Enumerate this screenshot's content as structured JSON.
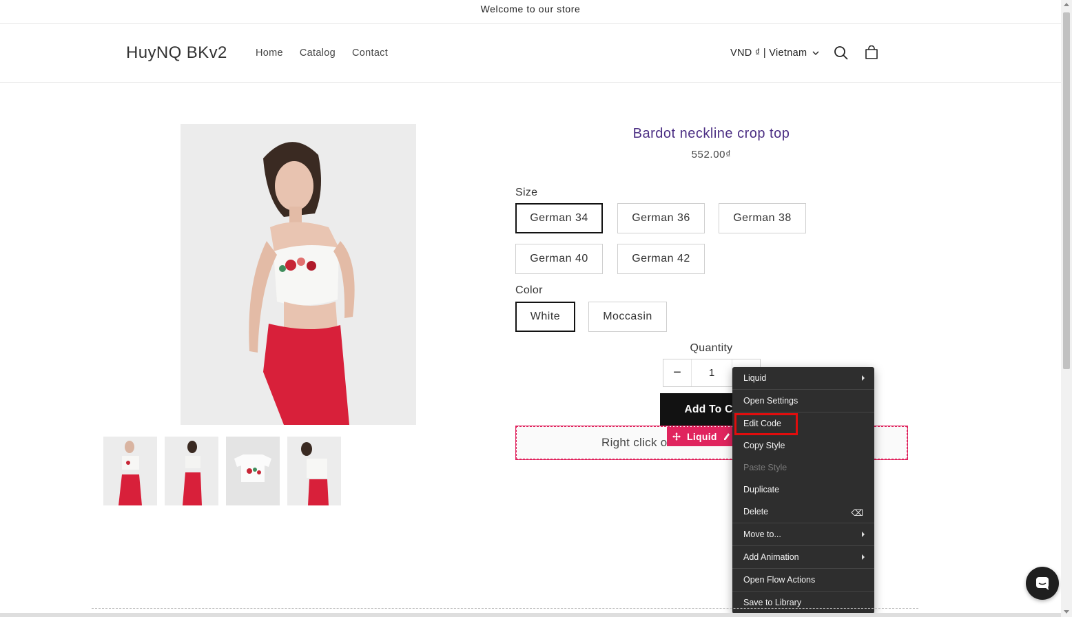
{
  "announcement": {
    "text": "Welcome to our store"
  },
  "header": {
    "logo": "HuyNQ BKv2",
    "nav": [
      "Home",
      "Catalog",
      "Contact"
    ],
    "currency": "VND ₫ | Vietnam",
    "icons": [
      "search-icon",
      "cart-icon",
      "chevron-down-icon"
    ]
  },
  "product": {
    "title": "Bardot neckline crop top",
    "price": "552.00₫",
    "size_label": "Size",
    "sizes": [
      "German 34",
      "German 36",
      "German 38",
      "German 40",
      "German 42"
    ],
    "selected_size": "German 34",
    "color_label": "Color",
    "colors": [
      "White",
      "Moccasin"
    ],
    "selected_color": "White",
    "quantity_label": "Quantity",
    "quantity": "1",
    "minus": "−",
    "add_to_cart": "Add To Ca"
  },
  "liquid": {
    "placeholder": "Right click o",
    "badge": "Liquid",
    "accent": "#e0245e"
  },
  "context_menu": {
    "items": [
      {
        "label": "Liquid",
        "submenu": true
      },
      {
        "label": "Open Settings"
      },
      {
        "label": "Edit Code",
        "highlighted": true
      },
      {
        "label": "Copy Style"
      },
      {
        "label": "Paste Style",
        "disabled": true
      },
      {
        "label": "Duplicate"
      },
      {
        "label": "Delete",
        "shortcut": "⌫"
      },
      {
        "label": "Move to...",
        "submenu": true
      },
      {
        "label": "Add Animation",
        "submenu": true
      },
      {
        "label": "Open Flow Actions"
      },
      {
        "label": "Save to Library"
      }
    ],
    "highlight_color": "#e10d0d"
  },
  "colors": {
    "title": "#4b2e83",
    "menu_bg": "#2e2e2e",
    "button_bg": "#121212"
  }
}
